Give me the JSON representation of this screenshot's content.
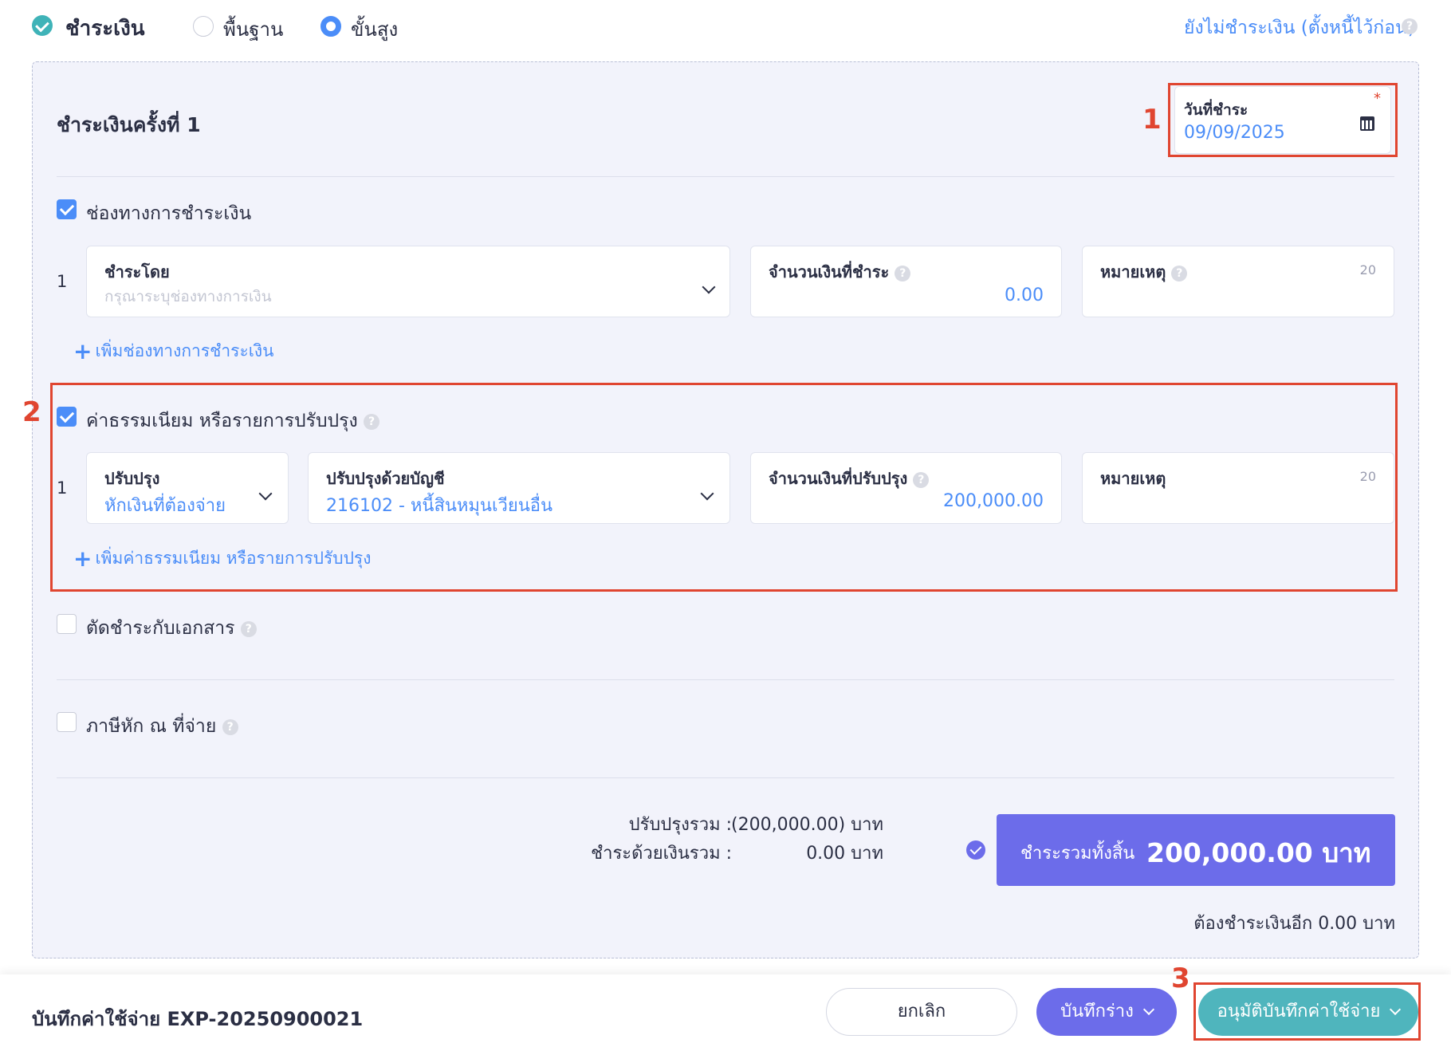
{
  "header": {
    "title": "ชำระเงิน",
    "option_basic": "พื้นฐาน",
    "option_advanced": "ขั้นสูง",
    "selected_option": "ขั้นสูง",
    "unpaid_link": "ยังไม่ชำระเงิน (ตั้งหนี้ไว้ก่อน)"
  },
  "payment": {
    "round_title": "ชำระเงินครั้งที่ 1",
    "date_label": "วันที่ชำระ",
    "date_value": "09/09/2025",
    "required_mark": "*"
  },
  "channels": {
    "label": "ช่องทางการชำระเงิน",
    "checked": true,
    "row_number": "1",
    "pay_by_label": "ชำระโดย",
    "pay_by_placeholder": "กรุณาระบุช่องทางการเงิน",
    "amount_label": "จำนวนเงินที่ชำระ",
    "amount_value": "0.00",
    "note_label": "หมายเหตุ",
    "note_count": "20",
    "add_link": "เพิ่มช่องทางการชำระเงิน"
  },
  "adjustments": {
    "label": "ค่าธรรมเนียม หรือรายการปรับปรุง",
    "checked": true,
    "row_number": "1",
    "type_label": "ปรับปรุง",
    "type_value": "หักเงินที่ต้องจ่าย",
    "account_label": "ปรับปรุงด้วยบัญชี",
    "account_value": "216102 - หนี้สินหมุนเวียนอื่น",
    "amount_label": "จำนวนเงินที่ปรับปรุง",
    "amount_value": "200,000.00",
    "note_label": "หมายเหตุ",
    "note_count": "20",
    "add_link": "เพิ่มค่าธรรมเนียม หรือรายการปรับปรุง"
  },
  "offset_documents": {
    "label": "ตัดชำระกับเอกสาร",
    "checked": false
  },
  "withholding_tax": {
    "label": "ภาษีหัก ณ ที่จ่าย",
    "checked": false
  },
  "summary": {
    "adjust_total_label": "ปรับปรุงรวม :",
    "adjust_total_value": "(200,000.00) บาท",
    "cash_total_label": "ชำระด้วยเงินรวม :",
    "cash_total_value": "0.00 บาท",
    "grand_total_label": "ชำระรวมทั้งสิ้น",
    "grand_total_value": "200,000.00 บาท",
    "remaining": "ต้องชำระเงินอีก 0.00 บาท"
  },
  "footer": {
    "doc_title": "บันทึกค่าใช้จ่าย EXP-20250900021",
    "cancel_button": "ยกเลิก",
    "draft_button": "บันทึกร่าง",
    "approve_button": "อนุมัติบันทึกค่าใช้จ่าย"
  },
  "annotations": {
    "marker_1": "1",
    "marker_2": "2",
    "marker_3": "3"
  },
  "colors": {
    "accent_blue": "#4b8df8",
    "teal": "#3fb3b8",
    "purple": "#6c6cea",
    "annotation_red": "#e04530"
  }
}
